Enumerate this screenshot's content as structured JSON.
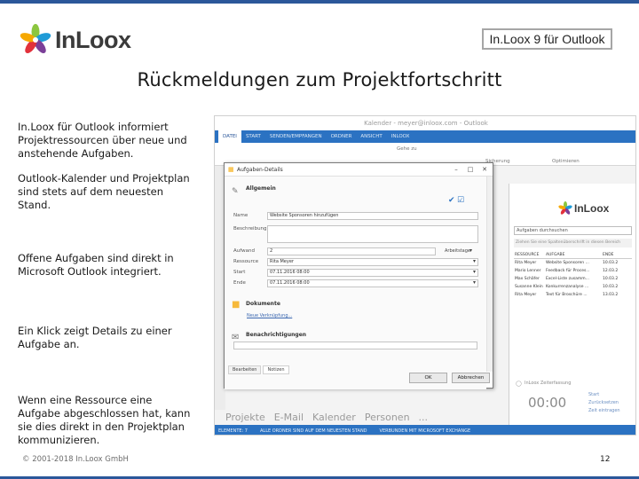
{
  "brand": {
    "logo_text": "InLoox",
    "colors": {
      "accent": "#2b579a",
      "petal_green": "#8cc63f",
      "petal_blue": "#1f9bd7",
      "petal_red": "#e2313b",
      "petal_yellow": "#f6a800",
      "petal_purple": "#7b3f98"
    }
  },
  "header": {
    "product": "In.Loox 9 für Outlook"
  },
  "slide": {
    "title": "Rückmeldungen zum Projektfortschritt"
  },
  "notes": [
    "In.Loox für Outlook informiert Projektressourcen über neue und anstehende Aufgaben.",
    "Outlook-Kalender und Projektplan sind stets auf dem neuesten Stand.",
    "Offene Aufgaben sind direkt in Microsoft Outlook integriert.",
    "Ein Klick zeigt Details zu einer Aufgabe an.",
    "Wenn eine Ressource eine Aufgabe abgeschlossen hat, kann sie dies direkt in den Projektplan kommunizieren."
  ],
  "footer": {
    "copyright": "© 2001-2018 In.Loox GmbH",
    "page": "12"
  },
  "screenshot": {
    "outlook_title": "Kalender - meyer@inloox.com - Outlook",
    "ribbon_tabs": [
      "DATEI",
      "START",
      "SENDEN/EMPFANGEN",
      "ORDNER",
      "ANSICHT",
      "INLOOX"
    ],
    "ribbon_labels": [
      "Gehe zu",
      "Sicherung",
      "Optimieren"
    ],
    "nav": [
      "Projekte",
      "E-Mail",
      "Kalender",
      "Personen",
      "..."
    ],
    "status": [
      "ELEMENTE: 7",
      "ALLE ORDNER SIND AUF DEM NEUESTEN STAND",
      "VERBUNDEN MIT MICROSOFT EXCHANGE"
    ],
    "dialog": {
      "title": "Aufgaben-Details",
      "section_general": "Allgemein",
      "labels": {
        "name": "Name",
        "description": "Beschreibung",
        "effort": "Aufwand",
        "resource": "Ressource",
        "start": "Start",
        "end": "Ende"
      },
      "values": {
        "name": "Website Sponsoren hinzufügen",
        "effort": "2",
        "effort_unit": "Arbeitstage",
        "resource": "Rita Meyer",
        "start": "07.11.2016 08:00",
        "end": "07.11.2016 08:00"
      },
      "section_documents": "Dokumente",
      "new_link": "Neue Verknüpfung...",
      "section_notifications": "Benachrichtigungen",
      "tabs": [
        "Bearbeiten",
        "Notizen"
      ],
      "ok": "OK",
      "cancel": "Abbrechen"
    },
    "pane": {
      "search": "Aufgaben durchsuchen",
      "hint": "Ziehen Sie eine Spaltenüberschrift in diesen Bereich",
      "columns": [
        "RESSOURCE",
        "AUFGABE",
        "ENDE"
      ],
      "rows": [
        [
          "Rita Meyer",
          "Website Sponsoren ...",
          "10.03.2"
        ],
        [
          "Mario Lenner",
          "Feedback für Proces...",
          "12.03.2"
        ],
        [
          "Max Schäfer",
          "Excel-Liste zusamm...",
          "10.03.2"
        ],
        [
          "Susanne Klein",
          "Konkurrenzanalyse ...",
          "10.03.2"
        ],
        [
          "Rita Meyer",
          "Text für Broschüre ...",
          "13.03.2"
        ]
      ],
      "timer_label": "InLoox Zeiterfassung",
      "timer": "00:00",
      "timer_links": [
        "Start",
        "Zurücksetzen",
        "Zeit eintragen"
      ]
    }
  }
}
